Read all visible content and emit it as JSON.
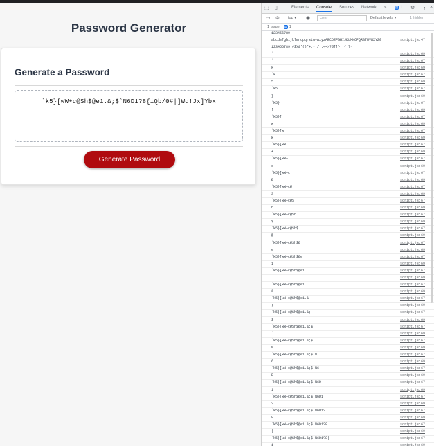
{
  "app": {
    "title": "Password Generator",
    "card_title": "Generate a Password",
    "password": "`k5}[wW+c@Sh$@e1.&;$`N6D1?8{iQb/0#|]Wd!Jx]Ybx",
    "button_label": "Generate Password",
    "accent_color": "#b00b0f"
  },
  "devtools": {
    "tabs": [
      "Elements",
      "Console",
      "Sources",
      "Network"
    ],
    "active_tab": "Console",
    "more_tabs": "»",
    "message_count": "1",
    "context": "top",
    "filter_placeholder": "Filter",
    "levels": "Default levels",
    "hidden": "1 hidden",
    "issues_label": "1 Issue:",
    "issues_count": "1",
    "top_line": "123456789`",
    "charset_lines": "abcdefghijklmnopqrstuvwxyzABCDEFGHIJKLMNOPQRSTUVWXYZ0\n123456789!#$%&'()*+,-./:;<=>?@[]^_`{|}~",
    "charset_src": "script.js:47",
    "logs": [
      {
        "msg": "`",
        "src": "script.js:69"
      },
      {
        "msg": "`",
        "src": "script.js:67"
      },
      {
        "msg": "k",
        "src": "script.js:69"
      },
      {
        "msg": "`k",
        "src": "script.js:67"
      },
      {
        "msg": "5",
        "src": "script.js:69"
      },
      {
        "msg": "`k5",
        "src": "script.js:67"
      },
      {
        "msg": "}",
        "src": "script.js:69"
      },
      {
        "msg": "`k5}",
        "src": "script.js:67"
      },
      {
        "msg": "[",
        "src": "script.js:69"
      },
      {
        "msg": "`k5}[",
        "src": "script.js:67"
      },
      {
        "msg": "w",
        "src": "script.js:69"
      },
      {
        "msg": "`k5}[w",
        "src": "script.js:67"
      },
      {
        "msg": "W",
        "src": "script.js:69"
      },
      {
        "msg": "`k5}[wW",
        "src": "script.js:67"
      },
      {
        "msg": "+",
        "src": "script.js:69"
      },
      {
        "msg": "`k5}[wW+",
        "src": "script.js:67"
      },
      {
        "msg": "c",
        "src": "script.js:69"
      },
      {
        "msg": "`k5}[wW+c",
        "src": "script.js:67"
      },
      {
        "msg": "@",
        "src": "script.js:69"
      },
      {
        "msg": "`k5}[wW+c@",
        "src": "script.js:67"
      },
      {
        "msg": "S",
        "src": "script.js:69"
      },
      {
        "msg": "`k5}[wW+c@S",
        "src": "script.js:67"
      },
      {
        "msg": "h",
        "src": "script.js:69"
      },
      {
        "msg": "`k5}[wW+c@Sh",
        "src": "script.js:67"
      },
      {
        "msg": "$",
        "src": "script.js:69"
      },
      {
        "msg": "`k5}[wW+c@Sh$",
        "src": "script.js:67"
      },
      {
        "msg": "@",
        "src": "script.js:69"
      },
      {
        "msg": "`k5}[wW+c@Sh$@",
        "src": "script.js:67"
      },
      {
        "msg": "e",
        "src": "script.js:69"
      },
      {
        "msg": "`k5}[wW+c@Sh$@e",
        "src": "script.js:67"
      },
      {
        "msg": "1",
        "src": "script.js:69"
      },
      {
        "msg": "`k5}[wW+c@Sh$@e1",
        "src": "script.js:67"
      },
      {
        "msg": ".",
        "src": "script.js:69"
      },
      {
        "msg": "`k5}[wW+c@Sh$@e1.",
        "src": "script.js:67"
      },
      {
        "msg": "&",
        "src": "script.js:69"
      },
      {
        "msg": "`k5}[wW+c@Sh$@e1.&",
        "src": "script.js:67"
      },
      {
        "msg": ";",
        "src": "script.js:69"
      },
      {
        "msg": "`k5}[wW+c@Sh$@e1.&;",
        "src": "script.js:67"
      },
      {
        "msg": "$",
        "src": "script.js:69"
      },
      {
        "msg": "`k5}[wW+c@Sh$@e1.&;$",
        "src": "script.js:67"
      },
      {
        "msg": "`",
        "src": "script.js:69"
      },
      {
        "msg": "`k5}[wW+c@Sh$@e1.&;$`",
        "src": "script.js:67"
      },
      {
        "msg": "N",
        "src": "script.js:69"
      },
      {
        "msg": "`k5}[wW+c@Sh$@e1.&;$`N",
        "src": "script.js:67"
      },
      {
        "msg": "6",
        "src": "script.js:69"
      },
      {
        "msg": "`k5}[wW+c@Sh$@e1.&;$`N6",
        "src": "script.js:67"
      },
      {
        "msg": "D",
        "src": "script.js:69"
      },
      {
        "msg": "`k5}[wW+c@Sh$@e1.&;$`N6D",
        "src": "script.js:67"
      },
      {
        "msg": "1",
        "src": "script.js:69"
      },
      {
        "msg": "`k5}[wW+c@Sh$@e1.&;$`N6D1",
        "src": "script.js:67"
      },
      {
        "msg": "?",
        "src": "script.js:69"
      },
      {
        "msg": "`k5}[wW+c@Sh$@e1.&;$`N6D1?",
        "src": "script.js:67"
      },
      {
        "msg": "8",
        "src": "script.js:69"
      },
      {
        "msg": "`k5}[wW+c@Sh$@e1.&;$`N6D1?8",
        "src": "script.js:67"
      },
      {
        "msg": "{",
        "src": "script.js:69"
      },
      {
        "msg": "`k5}[wW+c@Sh$@e1.&;$`N6D1?8{",
        "src": "script.js:67"
      },
      {
        "msg": "i",
        "src": "script.js:69"
      }
    ]
  }
}
